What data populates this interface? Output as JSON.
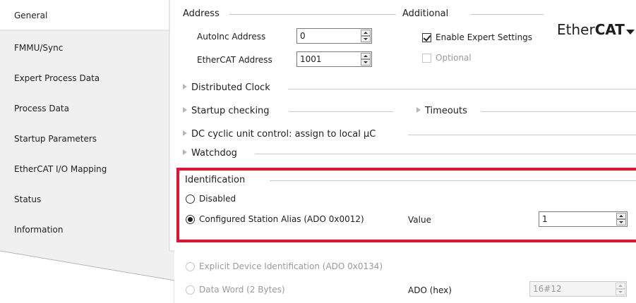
{
  "tabs": [
    {
      "label": "General"
    },
    {
      "label": "FMMU/Sync"
    },
    {
      "label": "Expert Process Data"
    },
    {
      "label": "Process Data"
    },
    {
      "label": "Startup Parameters"
    },
    {
      "label": "EtherCAT I/O Mapping"
    },
    {
      "label": "Status"
    },
    {
      "label": "Information"
    }
  ],
  "address": {
    "title": "Address",
    "autoinc_label": "AutoInc Address",
    "autoinc_value": "0",
    "ethercat_label": "EtherCAT Address",
    "ethercat_value": "1001"
  },
  "additional": {
    "title": "Additional",
    "expert_label": "Enable Expert Settings",
    "expert_checked": true,
    "optional_label": "Optional",
    "optional_checked": false
  },
  "logo": {
    "part1": "Ether",
    "part2": "CAT"
  },
  "sections": {
    "distributed_clock": "Distributed Clock",
    "startup_checking": "Startup checking",
    "timeouts": "Timeouts",
    "dc_cyclic": "DC cyclic unit control: assign to local µC",
    "watchdog": "Watchdog"
  },
  "identification": {
    "title": "Identification",
    "disabled_label": "Disabled",
    "configured_alias_label": "Configured Station Alias (ADO 0x0012)",
    "value_label": "Value",
    "value": "1",
    "explicit_label": "Explicit Device Identification (ADO 0x0134)",
    "data_word_label": "Data Word (2 Bytes)",
    "ado_label": "ADO (hex)",
    "ado_value": "16#12"
  },
  "colors": {
    "highlight": "#e8112d"
  }
}
